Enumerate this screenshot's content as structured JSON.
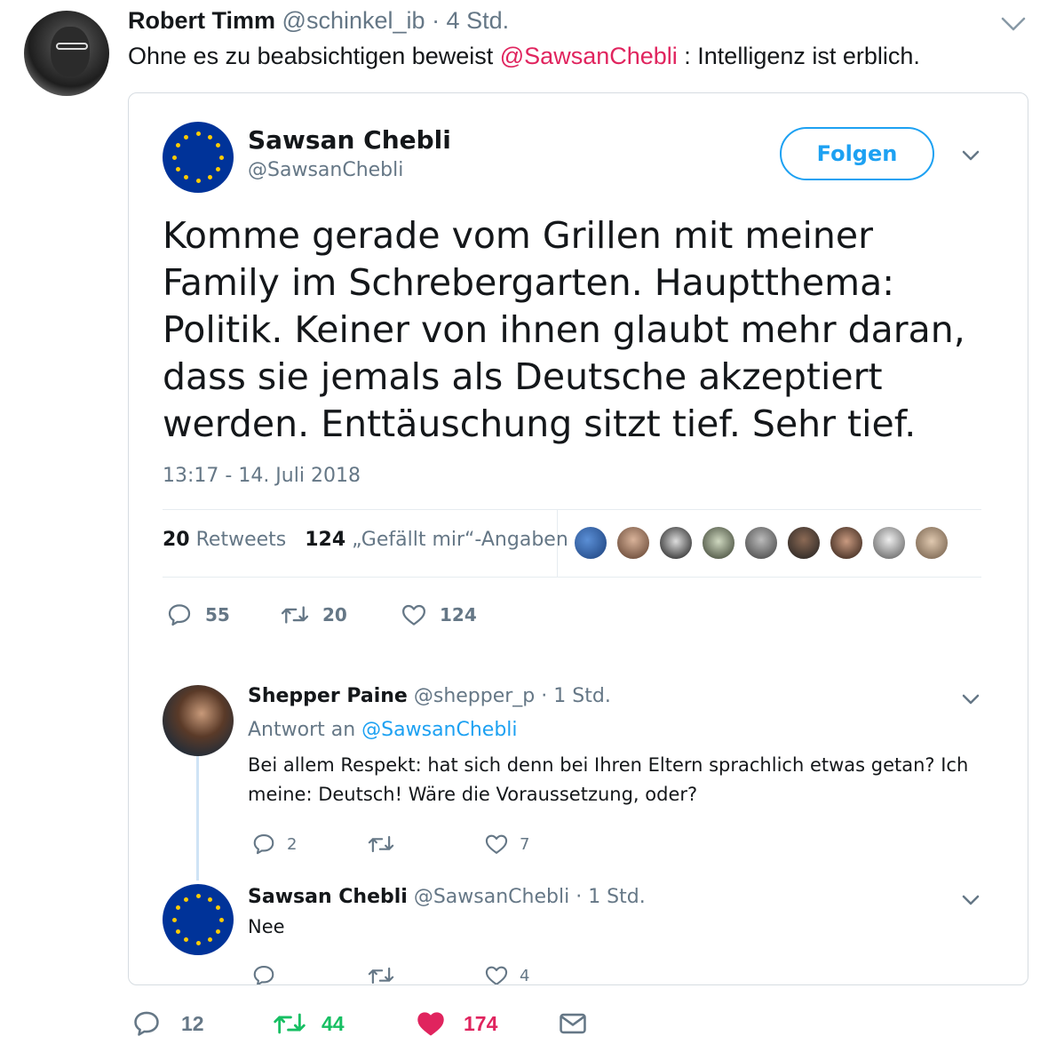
{
  "outer": {
    "name": "Robert Timm",
    "handle": "@schinkel_ib",
    "time": "· 4 Std.",
    "text_before": "Ohne es zu beabsichtigen beweist ",
    "mention": "@SawsanChebli",
    "text_after": " : Intelligenz ist erblich."
  },
  "embed": {
    "name": "Sawsan Chebli",
    "handle": "@SawsanChebli",
    "follow_label": "Folgen",
    "text": "Komme gerade vom Grillen mit meiner Family im Schrebergarten. Hauptthema: Politik. Keiner von ihnen glaubt mehr daran, dass sie jemals als Deutsche akzeptiert werden. Enttäuschung sitzt tief. Sehr tief.",
    "date": "13:17 - 14. Juli 2018",
    "retweets_count": "20",
    "retweets_label": "Retweets",
    "likes_count": "124",
    "likes_label": "„Gefällt mir“-Angaben",
    "actions": {
      "replies": "55",
      "retweets": "20",
      "likes": "124"
    }
  },
  "reply1": {
    "name": "Shepper Paine",
    "handle": "@shepper_p",
    "time": "· 1 Std.",
    "reply_to_label": "Antwort an",
    "reply_to_link": "@SawsanChebli",
    "text": "Bei allem Respekt: hat sich denn bei Ihren Eltern sprachlich etwas getan? Ich meine: Deutsch! Wäre die Voraussetzung, oder?",
    "actions": {
      "replies": "2",
      "retweets": "",
      "likes": "7"
    }
  },
  "reply2": {
    "name": "Sawsan Chebli",
    "handle": "@SawsanChebli",
    "time": "· 1 Std.",
    "text": "Nee",
    "actions": {
      "replies": "",
      "retweets": "",
      "likes": "4"
    }
  },
  "bottom": {
    "replies": "12",
    "retweets": "44",
    "likes": "174"
  },
  "colors": {
    "mention": "#e0245e",
    "link": "#1da1f2",
    "retweet_active": "#17bf63",
    "like_active": "#e0245e",
    "muted": "#657786"
  },
  "icons": [
    "reply-icon",
    "retweet-icon",
    "heart-icon",
    "mail-icon",
    "chevron-down-icon"
  ]
}
